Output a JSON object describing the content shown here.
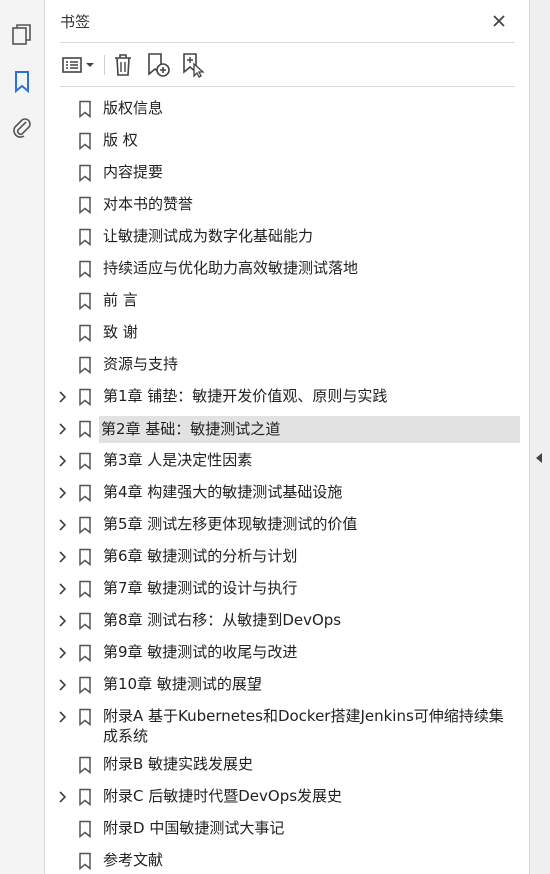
{
  "panel": {
    "title": "书签"
  },
  "icons": {
    "rail": [
      "pages-icon",
      "bookmarks-icon",
      "attachments-icon"
    ],
    "toolbar": [
      "options-menu-icon",
      "delete-bookmark-icon",
      "new-bookmark-icon",
      "add-bookmark-from-structure-icon"
    ]
  },
  "bookmarks": [
    {
      "label": "版权信息",
      "expandable": false
    },
    {
      "label": "版 权",
      "expandable": false
    },
    {
      "label": "内容提要",
      "expandable": false
    },
    {
      "label": "对本书的赞誉",
      "expandable": false
    },
    {
      "label": "让敏捷测试成为数字化基础能力",
      "expandable": false
    },
    {
      "label": "持续适应与优化助力高效敏捷测试落地",
      "expandable": false
    },
    {
      "label": "前 言",
      "expandable": false
    },
    {
      "label": "致 谢",
      "expandable": false
    },
    {
      "label": "资源与支持",
      "expandable": false
    },
    {
      "label": "第1章 铺垫：敏捷开发价值观、原则与实践",
      "expandable": true
    },
    {
      "label": "第2章 基础：敏捷测试之道",
      "expandable": true,
      "selected": true
    },
    {
      "label": "第3章 人是决定性因素",
      "expandable": true
    },
    {
      "label": "第4章 构建强大的敏捷测试基础设施",
      "expandable": true
    },
    {
      "label": "第5章 测试左移更体现敏捷测试的价值",
      "expandable": true
    },
    {
      "label": "第6章 敏捷测试的分析与计划",
      "expandable": true
    },
    {
      "label": "第7章 敏捷测试的设计与执行",
      "expandable": true
    },
    {
      "label": "第8章 测试右移：从敏捷到DevOps",
      "expandable": true
    },
    {
      "label": "第9章 敏捷测试的收尾与改进",
      "expandable": true
    },
    {
      "label": "第10章 敏捷测试的展望",
      "expandable": true
    },
    {
      "label": "附录A 基于Kubernetes和Docker搭建Jenkins可伸缩持续集成系统",
      "expandable": true,
      "wrap": true
    },
    {
      "label": "附录B 敏捷实践发展史",
      "expandable": false
    },
    {
      "label": "附录C 后敏捷时代暨DevOps发展史",
      "expandable": true
    },
    {
      "label": "附录D 中国敏捷测试大事记",
      "expandable": false
    },
    {
      "label": "参考文献",
      "expandable": false
    }
  ],
  "colors": {
    "accent": "#2a6fdb",
    "icon": "#555555",
    "selected_bg": "#e2e2e2"
  }
}
